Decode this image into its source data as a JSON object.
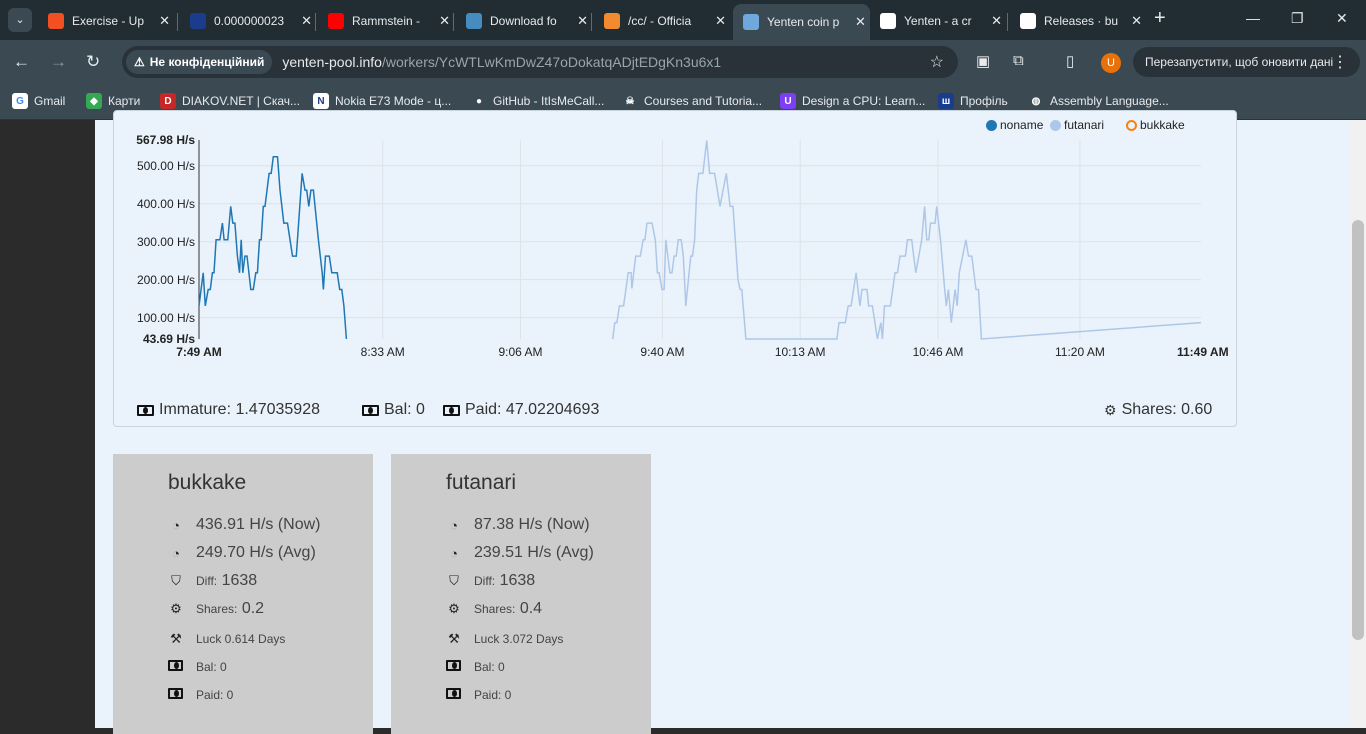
{
  "browser": {
    "tabs": [
      {
        "title": "Exercise - Up",
        "icon": "microsoft-icon",
        "color": "#f25022"
      },
      {
        "title": "0.000000023",
        "icon": "nine-icon",
        "color": "#1a3c8c"
      },
      {
        "title": "Rammstein -",
        "icon": "youtube-icon",
        "color": "#ff0000"
      },
      {
        "title": "Download fo",
        "icon": "godot-icon",
        "color": "#478cbf"
      },
      {
        "title": "/cc/ - Officia",
        "icon": "bolt-icon",
        "color": "#f28b30"
      },
      {
        "title": "Yenten coin p",
        "icon": "yenten-icon",
        "color": "#6fa8dc",
        "active": true
      },
      {
        "title": "Yenten - a cr",
        "icon": "qr-icon",
        "color": "#ffffff"
      },
      {
        "title": "Releases · bu",
        "icon": "github-icon",
        "color": "#ffffff"
      }
    ],
    "not_secure": "Не конфіденційний",
    "url_host": "yenten-pool.info",
    "url_path": "/workers/YcWTLwKmDwZ47oDokatqADjtEDgKn3u6x1",
    "profile_initial": "U",
    "restart_label": "Перезапустити, щоб оновити дані",
    "bookmarks": [
      "Gmail",
      "Карти",
      "DIAKOV.NET | Скач...",
      "Nokia E73 Mode - ц...",
      "GitHub - ItIsMeCall...",
      "Courses and Tutoria...",
      "Design a CPU: Learn...",
      "Профіль",
      "Assembly Language..."
    ]
  },
  "chart_data": {
    "type": "line",
    "ylim": [
      43.69,
      567.98
    ],
    "y_ticks": [
      "567.98 H/s",
      "500.00 H/s",
      "400.00 H/s",
      "300.00 H/s",
      "200.00 H/s",
      "100.00 H/s",
      "43.69 H/s"
    ],
    "y_tick_values": [
      567.98,
      500,
      400,
      300,
      200,
      100,
      43.69
    ],
    "x_range_minutes": [
      0,
      240
    ],
    "x_ticks": [
      "7:49 AM",
      "8:33 AM",
      "9:06 AM",
      "9:40 AM",
      "10:13 AM",
      "10:46 AM",
      "11:20 AM",
      "11:49 AM"
    ],
    "x_tick_minutes": [
      0,
      44,
      77,
      111,
      144,
      177,
      211,
      240
    ],
    "legend": [
      {
        "name": "noname",
        "color": "#1f77b4",
        "filled": true
      },
      {
        "name": "futanari",
        "color": "#aec7e8",
        "filled": true
      },
      {
        "name": "bukkake",
        "color": "#ff7f0e",
        "filled": false
      }
    ],
    "series": [
      {
        "name": "noname",
        "color": "#1f77b4",
        "points": [
          [
            0,
            131
          ],
          [
            1,
            218
          ],
          [
            1.5,
            131
          ],
          [
            2.2,
            174
          ],
          [
            2.7,
            174
          ],
          [
            3.2,
            218
          ],
          [
            3.6,
            218
          ],
          [
            4.1,
            305
          ],
          [
            5,
            305
          ],
          [
            5.6,
            349
          ],
          [
            6,
            305
          ],
          [
            6.9,
            305
          ],
          [
            7.6,
            393
          ],
          [
            8.1,
            349
          ],
          [
            8.6,
            349
          ],
          [
            9.2,
            262
          ],
          [
            9.7,
            218
          ],
          [
            10.1,
            305
          ],
          [
            10.5,
            218
          ],
          [
            11,
            262
          ],
          [
            11.5,
            262
          ],
          [
            12.4,
            174
          ],
          [
            13,
            174
          ],
          [
            13.6,
            218
          ],
          [
            14,
            218
          ],
          [
            14.5,
            305
          ],
          [
            14.9,
            305
          ],
          [
            15.4,
            393
          ],
          [
            15.8,
            393
          ],
          [
            16.8,
            480
          ],
          [
            17.3,
            480
          ],
          [
            17.8,
            524
          ],
          [
            18.8,
            524
          ],
          [
            19.4,
            436
          ],
          [
            20.3,
            349
          ],
          [
            21.2,
            349
          ],
          [
            22.4,
            262
          ],
          [
            23.3,
            262
          ],
          [
            24.7,
            480
          ],
          [
            25.4,
            436
          ],
          [
            25.8,
            436
          ],
          [
            26.3,
            393
          ],
          [
            26.8,
            436
          ],
          [
            27.4,
            436
          ],
          [
            28.6,
            305
          ],
          [
            29.5,
            218
          ],
          [
            29.8,
            174
          ],
          [
            30.3,
            262
          ],
          [
            31.2,
            262
          ],
          [
            31.8,
            218
          ],
          [
            33.1,
            218
          ],
          [
            33.7,
            174
          ],
          [
            34.2,
            174
          ],
          [
            34.7,
            131
          ],
          [
            35.3,
            43.69
          ]
        ]
      },
      {
        "name": "futanari",
        "color": "#aec7e8",
        "points": [
          [
            99.1,
            43.69
          ],
          [
            99.6,
            87
          ],
          [
            100.1,
            87
          ],
          [
            100.7,
            131
          ],
          [
            101.7,
            131
          ],
          [
            102.8,
            218
          ],
          [
            103.5,
            218
          ],
          [
            103.7,
            177
          ],
          [
            104.6,
            262
          ],
          [
            105.7,
            262
          ],
          [
            106.4,
            305
          ],
          [
            106.8,
            305
          ],
          [
            107.3,
            349
          ],
          [
            108.5,
            349
          ],
          [
            109.3,
            305
          ],
          [
            109.8,
            218
          ],
          [
            110.2,
            218
          ],
          [
            110.9,
            174
          ],
          [
            111.4,
            174
          ],
          [
            111.8,
            305
          ],
          [
            112.8,
            218
          ],
          [
            113.3,
            218
          ],
          [
            113.8,
            262
          ],
          [
            114.3,
            262
          ],
          [
            114.8,
            305
          ],
          [
            115.5,
            305
          ],
          [
            116,
            262
          ],
          [
            116.6,
            131
          ],
          [
            117.4,
            218
          ],
          [
            117.8,
            262
          ],
          [
            118.2,
            262
          ],
          [
            118.7,
            305
          ],
          [
            119.2,
            436
          ],
          [
            119.7,
            480
          ],
          [
            120.7,
            480
          ],
          [
            121.6,
            567
          ],
          [
            122.3,
            480
          ],
          [
            123.5,
            480
          ],
          [
            124.8,
            393
          ],
          [
            126.3,
            480
          ],
          [
            127.2,
            393
          ],
          [
            127.9,
            393
          ],
          [
            129.1,
            200
          ],
          [
            129.6,
            174
          ],
          [
            130,
            174
          ],
          [
            131,
            43.69
          ],
          [
            152.8,
            43.69
          ],
          [
            153.3,
            87
          ],
          [
            154.8,
            87
          ],
          [
            155.5,
            131
          ],
          [
            156.2,
            131
          ],
          [
            157.4,
            218
          ],
          [
            158.3,
            131
          ],
          [
            158.8,
            174
          ],
          [
            160,
            174
          ],
          [
            160.4,
            131
          ],
          [
            161.3,
            131
          ],
          [
            162.5,
            43.69
          ],
          [
            163.3,
            87
          ],
          [
            163.7,
            43.69
          ],
          [
            164.2,
            131
          ],
          [
            165.6,
            131
          ],
          [
            166.7,
            218
          ],
          [
            167.3,
            218
          ],
          [
            167.9,
            262
          ],
          [
            169.2,
            262
          ],
          [
            169.7,
            305
          ],
          [
            170.7,
            305
          ],
          [
            171.7,
            218
          ],
          [
            172.4,
            262
          ],
          [
            173.1,
            305
          ],
          [
            173.8,
            393
          ],
          [
            174.3,
            305
          ],
          [
            174.8,
            305
          ],
          [
            175.2,
            349
          ],
          [
            176.3,
            349
          ],
          [
            176.7,
            393
          ],
          [
            177.6,
            305
          ],
          [
            178.6,
            174
          ],
          [
            179,
            131
          ],
          [
            179.5,
            174
          ],
          [
            180.2,
            87
          ],
          [
            181.1,
            174
          ],
          [
            181.6,
            131
          ],
          [
            182.1,
            218
          ],
          [
            182.9,
            262
          ],
          [
            183.7,
            305
          ],
          [
            184.3,
            262
          ],
          [
            185.1,
            262
          ],
          [
            186.1,
            174
          ],
          [
            186.7,
            174
          ],
          [
            187.4,
            43.69
          ],
          [
            240,
            87
          ]
        ]
      },
      {
        "name": "bukkake",
        "color": "#ff7f0e",
        "points": []
      }
    ]
  },
  "summary": {
    "immature": "Immature: 1.47035928",
    "bal": "Bal: 0",
    "paid": "Paid: 47.02204693",
    "shares": "Shares: 0.60"
  },
  "workers": [
    {
      "name": "bukkake",
      "now": "436.91 H/s (Now)",
      "avg": "249.70 H/s (Avg)",
      "diff_label": "Diff:",
      "diff": "1638",
      "shares_label": "Shares:",
      "shares": "0.2",
      "luck": "Luck 0.614 Days",
      "bal": "Bal: 0",
      "paid": "Paid: 0"
    },
    {
      "name": "futanari",
      "now": "87.38 H/s (Now)",
      "avg": "239.51 H/s (Avg)",
      "diff_label": "Diff:",
      "diff": "1638",
      "shares_label": "Shares:",
      "shares": "0.4",
      "luck": "Luck 3.072 Days",
      "bal": "Bal: 0",
      "paid": "Paid: 0"
    }
  ]
}
